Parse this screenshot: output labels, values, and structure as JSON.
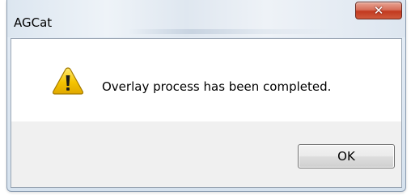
{
  "window": {
    "title": "AGCat",
    "close_glyph": "✕"
  },
  "message": {
    "icon": "warning-icon",
    "text": "Overlay process has been completed."
  },
  "buttons": {
    "ok_label": "OK"
  },
  "colors": {
    "close_button": "#c2391f",
    "warning_fill": "#f5c400",
    "content_background": "#f0f0f0",
    "message_background": "#ffffff"
  }
}
